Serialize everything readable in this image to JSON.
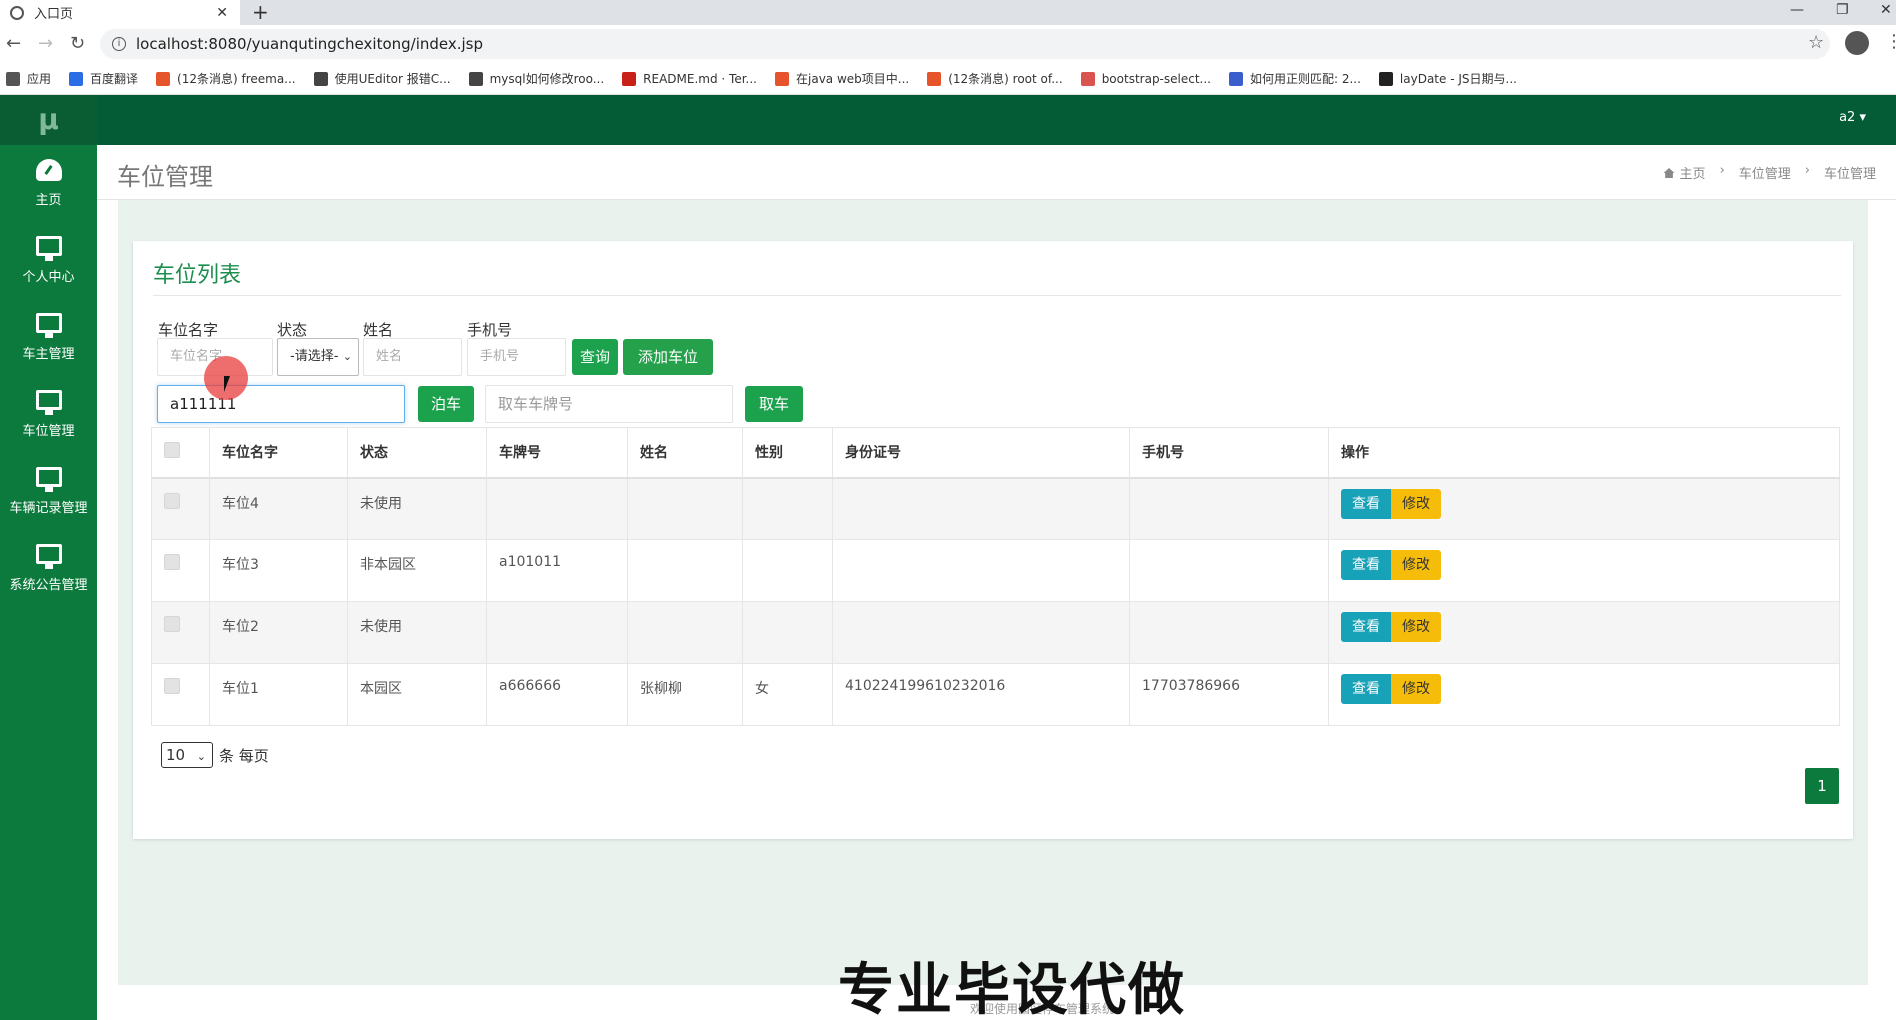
{
  "browser": {
    "tab_title": "入口页",
    "url": "localhost:8080/yuanqutingchexitong/index.jsp",
    "bookmarks": [
      {
        "label": "应用",
        "color": "#555"
      },
      {
        "label": "百度翻译",
        "color": "#2b6de5"
      },
      {
        "label": "(12条消息) freema...",
        "color": "#e5542b"
      },
      {
        "label": "使用UEditor 报错C...",
        "color": "#444"
      },
      {
        "label": "mysql如何修改roo...",
        "color": "#444"
      },
      {
        "label": "README.md · Ter...",
        "color": "#c7211a"
      },
      {
        "label": "在java web项目中...",
        "color": "#e5542b"
      },
      {
        "label": "(12条消息) root of...",
        "color": "#e5542b"
      },
      {
        "label": "bootstrap-select...",
        "color": "#d9534f"
      },
      {
        "label": "如何用正则匹配: 2...",
        "color": "#3a5fcd"
      },
      {
        "label": "layDate - JS日期与...",
        "color": "#222"
      }
    ]
  },
  "app": {
    "logo": "μ",
    "user": "a2 ▾",
    "sidebar": [
      {
        "label": "主页"
      },
      {
        "label": "个人中心"
      },
      {
        "label": "车主管理"
      },
      {
        "label": "车位管理"
      },
      {
        "label": "车辆记录管理"
      },
      {
        "label": "系统公告管理"
      }
    ],
    "page_title": "车位管理",
    "breadcrumb": [
      "主页",
      "车位管理",
      "车位管理"
    ]
  },
  "card": {
    "title": "车位列表",
    "filters": {
      "name_label": "车位名字",
      "name_placeholder": "车位名字",
      "status_label": "状态",
      "status_value": "-请选择-",
      "person_label": "姓名",
      "person_placeholder": "姓名",
      "phone_label": "手机号",
      "phone_placeholder": "手机号",
      "query_btn": "查询",
      "add_btn": "添加车位"
    },
    "park": {
      "plate_value": "a111111",
      "park_btn": "泊车",
      "take_placeholder": "取车车牌号",
      "take_btn": "取车"
    },
    "table": {
      "headers": [
        "车位名字",
        "状态",
        "车牌号",
        "姓名",
        "性别",
        "身份证号",
        "手机号",
        "操作"
      ],
      "rows": [
        [
          "车位4",
          "未使用",
          "",
          "",
          "",
          "",
          ""
        ],
        [
          "车位3",
          "非本园区",
          "a101011",
          "",
          "",
          "",
          ""
        ],
        [
          "车位2",
          "未使用",
          "",
          "",
          "",
          "",
          ""
        ],
        [
          "车位1",
          "本园区",
          "a666666",
          "张柳柳",
          "女",
          "410224199610232016",
          "17703786966"
        ]
      ],
      "view_btn": "查看",
      "edit_btn": "修改"
    },
    "pagesize": "10",
    "pagesize_suffix": "条 每页",
    "page": "1"
  },
  "footer": "欢迎使用园区停车管理系统",
  "watermark": "专业毕设代做"
}
